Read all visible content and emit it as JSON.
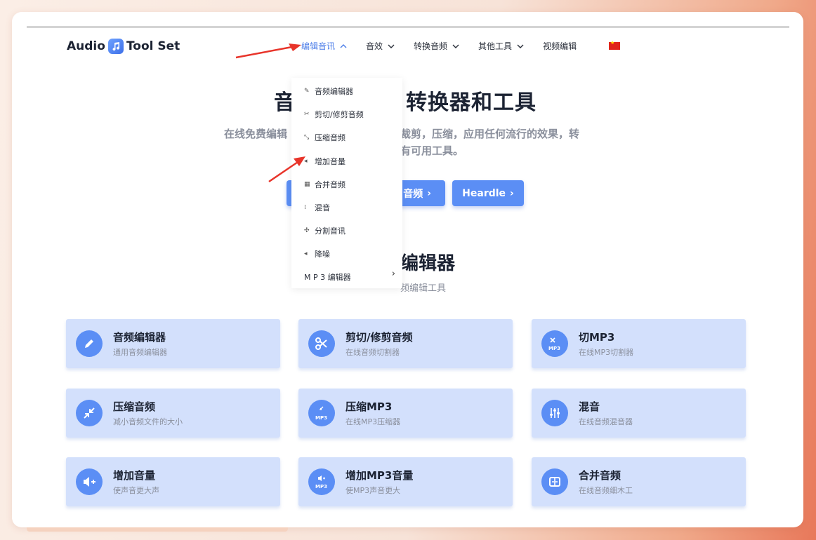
{
  "header": {
    "logo_left": "Audio",
    "logo_right": "Tool Set",
    "nav": [
      {
        "label": "编辑音讯"
      },
      {
        "label": "音效"
      },
      {
        "label": "转换音频"
      },
      {
        "label": "其他工具"
      },
      {
        "label": "视频编辑"
      }
    ],
    "accent": "#4d7ee8"
  },
  "dropdown": {
    "items": [
      {
        "label": "音频编辑器"
      },
      {
        "label": "剪切/修剪音频"
      },
      {
        "label": "压缩音频"
      },
      {
        "label": "增加音量"
      },
      {
        "label": "合并音频"
      },
      {
        "label": "混音"
      },
      {
        "label": "分割音讯"
      },
      {
        "label": "降噪"
      },
      {
        "label": "M P 3 编辑器"
      }
    ]
  },
  "hero": {
    "title_left": "音",
    "title_right": "转换器和工具",
    "sub1_left": "在线免费编辑",
    "sub1_right": "裁剪，压缩，应用任何流行的效果，转",
    "sub2_right": "有可用工具。",
    "btn1_label": "音频",
    "btn2_label": "Heardle"
  },
  "section": {
    "title": "编辑器",
    "sub": "频编辑工具"
  },
  "tiles": [
    {
      "title": "音频编辑器",
      "sub": "通用音频编辑器",
      "icon": "pencil-icon"
    },
    {
      "title": "剪切/修剪音频",
      "sub": "在线音频切割器",
      "icon": "scissors-icon"
    },
    {
      "title": "切MP3",
      "sub": "在线MP3切割器",
      "icon": "mp3-scissors-icon"
    },
    {
      "title": "压缩音频",
      "sub": "减小音频文件的大小",
      "icon": "compress-icon"
    },
    {
      "title": "压缩MP3",
      "sub": "在线MP3压缩器",
      "icon": "mp3-compress-icon"
    },
    {
      "title": "混音",
      "sub": "在线音频混音器",
      "icon": "mixer-icon"
    },
    {
      "title": "增加音量",
      "sub": "使声音更大声",
      "icon": "volume-up-icon"
    },
    {
      "title": "增加MP3音量",
      "sub": "使MP3声音更大",
      "icon": "mp3-volume-icon"
    },
    {
      "title": "合并音频",
      "sub": "在线音频细木工",
      "icon": "merge-icon"
    }
  ],
  "colors": {
    "tile_bg": "#d3e0fc",
    "button": "#5b8ef5",
    "annotation_arrow": "#e8342a"
  }
}
